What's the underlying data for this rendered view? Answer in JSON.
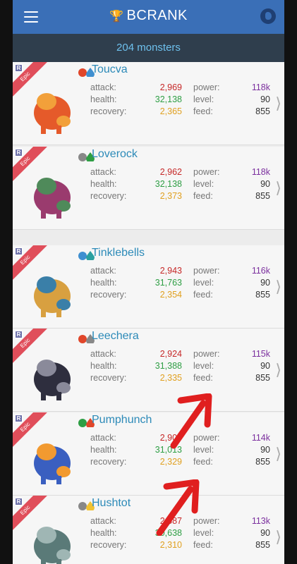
{
  "app": {
    "brand": "BCRANK",
    "count_label": "204 monsters"
  },
  "stat_labels": {
    "attack": "attack:",
    "health": "health:",
    "recovery": "recovery:",
    "power": "power:",
    "level": "level:",
    "feed": "feed:"
  },
  "badge": {
    "rarity": "Epic",
    "r": "R"
  },
  "monsters": [
    {
      "name": "Toucva",
      "attack": "2,969",
      "health": "32,138",
      "recovery": "2,365",
      "power": "118k",
      "level": "90",
      "feed": "855",
      "elements": [
        "#e0462a",
        "#3f8fd0"
      ]
    },
    {
      "name": "Loverock",
      "attack": "2,962",
      "health": "32,138",
      "recovery": "2,373",
      "power": "118k",
      "level": "90",
      "feed": "855",
      "elements": [
        "#888888",
        "#2e9e44"
      ]
    },
    {
      "name": "Tinklebells",
      "attack": "2,943",
      "health": "31,763",
      "recovery": "2,354",
      "power": "116k",
      "level": "90",
      "feed": "855",
      "elements": [
        "#3f8fd0",
        "#2aa0a0"
      ]
    },
    {
      "name": "Leechera",
      "attack": "2,924",
      "health": "31,388",
      "recovery": "2,335",
      "power": "115k",
      "level": "90",
      "feed": "855",
      "elements": [
        "#e0462a",
        "#888888"
      ]
    },
    {
      "name": "Pumphunch",
      "attack": "2,905",
      "health": "31,013",
      "recovery": "2,329",
      "power": "114k",
      "level": "90",
      "feed": "855",
      "elements": [
        "#2e9e44",
        "#e0462a"
      ]
    },
    {
      "name": "Hushtot",
      "attack": "2,887",
      "health": "30,638",
      "recovery": "2,310",
      "power": "113k",
      "level": "90",
      "feed": "855",
      "elements": [
        "#888888",
        "#f1c232"
      ]
    }
  ],
  "colors": {
    "appbar": "#3a6fb7",
    "countbar": "#2f3e4d",
    "annotation_arrow": "#e01f1f"
  }
}
